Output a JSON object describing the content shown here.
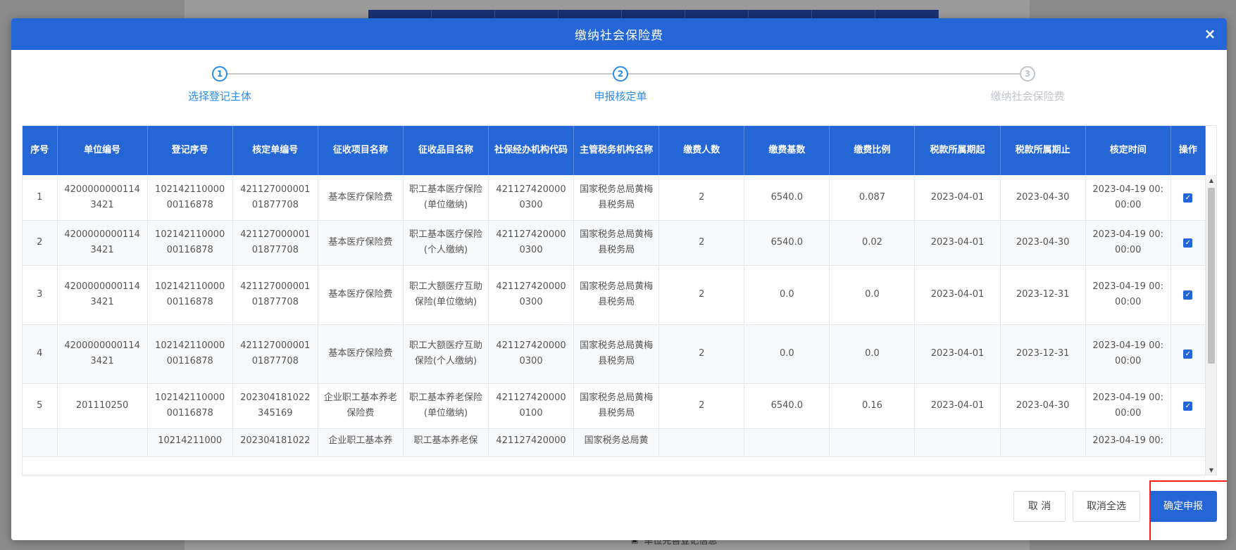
{
  "background": {
    "footnote": "单位完善登记信息",
    "footnote_icon": "id-card-icon"
  },
  "modal": {
    "title": "缴纳社会保险费",
    "close_icon": "×"
  },
  "steps": [
    {
      "number": "1",
      "label": "选择登记主体",
      "state": "done"
    },
    {
      "number": "2",
      "label": "申报核定单",
      "state": "active"
    },
    {
      "number": "3",
      "label": "缴纳社会保险费",
      "state": "pending"
    }
  ],
  "table": {
    "headers": [
      "序号",
      "单位编号",
      "登记序号",
      "核定单编号",
      "征收项目名称",
      "征收品目名称",
      "社保经办机构代码",
      "主管税务机构名称",
      "缴费人数",
      "缴费基数",
      "缴费比例",
      "税款所属期起",
      "税款所属期止",
      "核定时间",
      "操作"
    ],
    "rows": [
      [
        "1",
        "42000000001143421",
        "10214211000000116878",
        "42112700000101877708",
        "基本医疗保险费",
        "职工基本医疗保险(单位缴纳)",
        "4211274200000300",
        "国家税务总局黄梅县税务局",
        "2",
        "6540.0",
        "0.087",
        "2023-04-01",
        "2023-04-30",
        "2023-04-19 00:00:00"
      ],
      [
        "2",
        "42000000001143421",
        "10214211000000116878",
        "42112700000101877708",
        "基本医疗保险费",
        "职工基本医疗保险(个人缴纳)",
        "4211274200000300",
        "国家税务总局黄梅县税务局",
        "2",
        "6540.0",
        "0.02",
        "2023-04-01",
        "2023-04-30",
        "2023-04-19 00:00:00"
      ],
      [
        "3",
        "42000000001143421",
        "10214211000000116878",
        "42112700000101877708",
        "基本医疗保险费",
        "职工大额医疗互助保险(单位缴纳)",
        "4211274200000300",
        "国家税务总局黄梅县税务局",
        "2",
        "0.0",
        "0.0",
        "2023-04-01",
        "2023-12-31",
        "2023-04-19 00:00:00"
      ],
      [
        "4",
        "42000000001143421",
        "10214211000000116878",
        "42112700000101877708",
        "基本医疗保险费",
        "职工大额医疗互助保险(个人缴纳)",
        "4211274200000300",
        "国家税务总局黄梅县税务局",
        "2",
        "0.0",
        "0.0",
        "2023-04-01",
        "2023-12-31",
        "2023-04-19 00:00:00"
      ],
      [
        "5",
        "201110250",
        "10214211000000116878",
        "202304181022345169",
        "企业职工基本养老保险费",
        "职工基本养老保险(单位缴纳)",
        "4211274200000100",
        "国家税务总局黄梅县税务局",
        "2",
        "6540.0",
        "0.16",
        "2023-04-01",
        "2023-04-30",
        "2023-04-19 00:00:00"
      ],
      [
        "",
        "",
        "10214211000",
        "202304181022",
        "企业职工基本养",
        "职工基本养老保",
        "421127420000",
        "国家税务总局黄",
        "",
        "",
        "",
        "",
        "",
        "2023-04-19 00:"
      ]
    ],
    "row_checked": [
      true,
      true,
      true,
      true,
      true,
      false
    ]
  },
  "footer": {
    "cancel_label": "取 消",
    "deselect_all_label": "取消全选",
    "confirm_label": "确定申报"
  },
  "colors": {
    "primary": "#2466d6",
    "step_active": "#2b8be6",
    "highlight": "#ff1a1a"
  }
}
